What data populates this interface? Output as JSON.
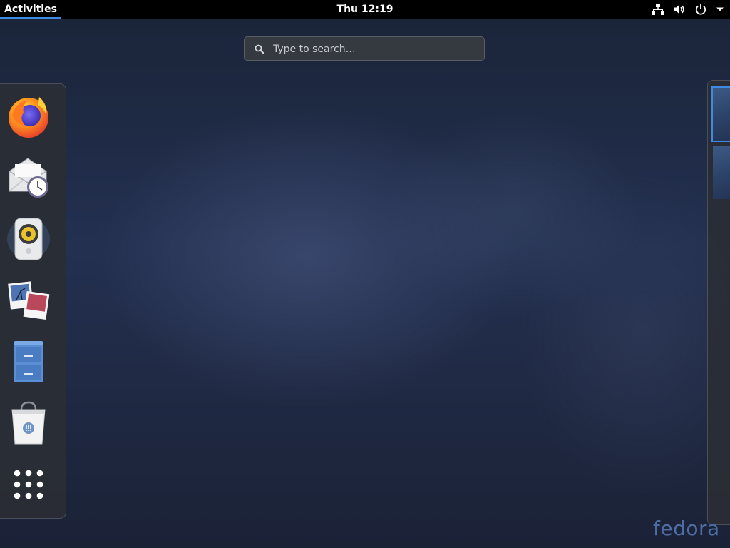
{
  "topbar": {
    "activities_label": "Activities",
    "clock": "Thu 12:19",
    "status_icons": [
      "network-wired-icon",
      "volume-icon",
      "power-icon",
      "chevron-down-icon"
    ]
  },
  "search": {
    "placeholder": "Type to search…"
  },
  "dash": {
    "items": [
      {
        "name": "Firefox",
        "icon": "firefox-icon"
      },
      {
        "name": "Evolution",
        "icon": "mail-clock-icon"
      },
      {
        "name": "Rhythmbox",
        "icon": "speaker-icon"
      },
      {
        "name": "Shotwell",
        "icon": "photos-icon"
      },
      {
        "name": "Files",
        "icon": "file-cabinet-icon"
      },
      {
        "name": "Software",
        "icon": "software-bag-icon"
      },
      {
        "name": "Show Applications",
        "icon": "app-grid-icon"
      }
    ]
  },
  "workspaces": {
    "count": 2,
    "active": 1
  },
  "watermark": {
    "text": "fedora"
  },
  "colors": {
    "accent": "#3f8ae2",
    "topbar": "#000000",
    "dash_bg": "#2a2e34"
  }
}
